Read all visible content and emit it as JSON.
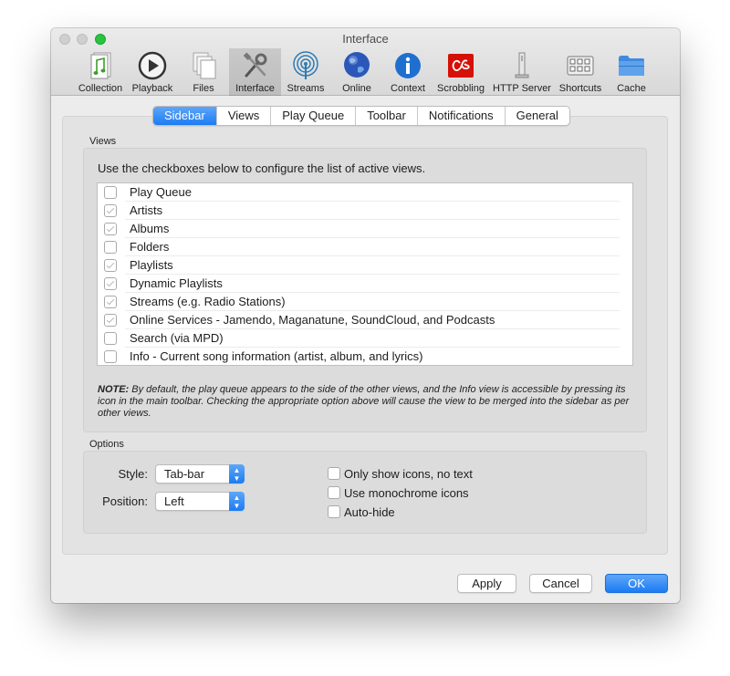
{
  "window": {
    "title": "Interface"
  },
  "toolbar": {
    "items": [
      {
        "label": "Collection",
        "icon": "collection-icon"
      },
      {
        "label": "Playback",
        "icon": "playback-icon"
      },
      {
        "label": "Files",
        "icon": "files-icon"
      },
      {
        "label": "Interface",
        "icon": "interface-icon",
        "selected": true
      },
      {
        "label": "Streams",
        "icon": "streams-icon"
      },
      {
        "label": "Online",
        "icon": "online-icon"
      },
      {
        "label": "Context",
        "icon": "context-icon"
      },
      {
        "label": "Scrobbling",
        "icon": "scrobbling-icon"
      },
      {
        "label": "HTTP Server",
        "icon": "http-server-icon"
      },
      {
        "label": "Shortcuts",
        "icon": "shortcuts-icon"
      },
      {
        "label": "Cache",
        "icon": "cache-icon"
      }
    ]
  },
  "tabs": [
    {
      "label": "Sidebar",
      "active": true
    },
    {
      "label": "Views"
    },
    {
      "label": "Play Queue"
    },
    {
      "label": "Toolbar"
    },
    {
      "label": "Notifications"
    },
    {
      "label": "General"
    }
  ],
  "views": {
    "group_label": "Views",
    "intro": "Use the checkboxes below to configure the list of active views.",
    "items": [
      {
        "label": "Play Queue",
        "checked": false
      },
      {
        "label": "Artists",
        "checked": true
      },
      {
        "label": "Albums",
        "checked": true
      },
      {
        "label": "Folders",
        "checked": false
      },
      {
        "label": "Playlists",
        "checked": true
      },
      {
        "label": "Dynamic Playlists",
        "checked": true
      },
      {
        "label": "Streams (e.g. Radio Stations)",
        "checked": true
      },
      {
        "label": "Online Services - Jamendo, Maganatune, SoundCloud, and Podcasts",
        "checked": true
      },
      {
        "label": "Search (via MPD)",
        "checked": false
      },
      {
        "label": "Info - Current song information (artist, album, and lyrics)",
        "checked": false
      }
    ],
    "note_prefix": "NOTE:",
    "note_text": " By default, the play queue appears to the side of the other views, and the Info view is accessible by pressing its icon in the main toolbar. Checking the appropriate option above will cause the view to be merged into the sidebar as per other views."
  },
  "options": {
    "group_label": "Options",
    "style_label": "Style:",
    "style_value": "Tab-bar",
    "position_label": "Position:",
    "position_value": "Left",
    "checks": [
      {
        "label": "Only show icons, no text",
        "checked": false
      },
      {
        "label": "Use monochrome icons",
        "checked": false
      },
      {
        "label": "Auto-hide",
        "checked": false
      }
    ]
  },
  "buttons": {
    "apply": "Apply",
    "cancel": "Cancel",
    "ok": "OK"
  },
  "colors": {
    "accent": "#1b7cf3",
    "zoom": "#29c33f"
  }
}
